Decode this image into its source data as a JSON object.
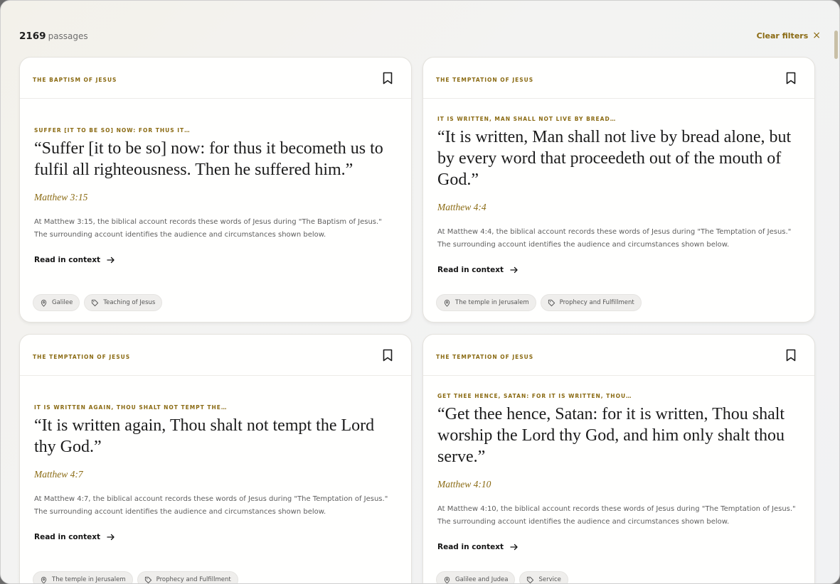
{
  "header": {
    "count": "2169",
    "count_label": "passages",
    "clear_label": "Clear filters",
    "clear_icon": "×"
  },
  "cards": [
    {
      "event": "THE BAPTISM OF JESUS",
      "kicker": "SUFFER [IT TO BE SO] NOW: FOR THUS IT…",
      "quote": "“Suffer [it to be so] now: for thus it becometh us to fulfil all righteousness. Then he suffered him.”",
      "ref": "Matthew 3:15",
      "desc": "At Matthew 3:15, the biblical account records these words of Jesus during \"The Baptism of Jesus.\" The surrounding account identifies the audience and circumstances shown below.",
      "read_label": "Read in context",
      "tags": [
        {
          "icon": "location-icon",
          "label": "Galilee"
        },
        {
          "icon": "tag-icon",
          "label": "Teaching of Jesus"
        }
      ]
    },
    {
      "event": "THE TEMPTATION OF JESUS",
      "kicker": "IT IS WRITTEN, MAN SHALL NOT LIVE BY BREAD…",
      "quote": "“It is written, Man shall not live by bread alone, but by every word that proceedeth out of the mouth of God.”",
      "ref": "Matthew 4:4",
      "desc": "At Matthew 4:4, the biblical account records these words of Jesus during \"The Temptation of Jesus.\" The surrounding account identifies the audience and circumstances shown below.",
      "read_label": "Read in context",
      "tags": [
        {
          "icon": "location-icon",
          "label": "The temple in Jerusalem"
        },
        {
          "icon": "tag-icon",
          "label": "Prophecy and Fulfillment"
        }
      ]
    },
    {
      "event": "THE TEMPTATION OF JESUS",
      "kicker": "IT IS WRITTEN AGAIN, THOU SHALT NOT TEMPT THE…",
      "quote": "“It is written again, Thou shalt not tempt the Lord thy God.”",
      "ref": "Matthew 4:7",
      "desc": "At Matthew 4:7, the biblical account records these words of Jesus during \"The Temptation of Jesus.\" The surrounding account identifies the audience and circumstances shown below.",
      "read_label": "Read in context",
      "tags": [
        {
          "icon": "location-icon",
          "label": "The temple in Jerusalem"
        },
        {
          "icon": "tag-icon",
          "label": "Prophecy and Fulfillment"
        }
      ]
    },
    {
      "event": "THE TEMPTATION OF JESUS",
      "kicker": "GET THEE HENCE, SATAN: FOR IT IS WRITTEN, THOU…",
      "quote": "“Get thee hence, Satan: for it is written, Thou shalt worship the Lord thy God, and him only shalt thou serve.”",
      "ref": "Matthew 4:10",
      "desc": "At Matthew 4:10, the biblical account records these words of Jesus during \"The Temptation of Jesus.\" The surrounding account identifies the audience and circumstances shown below.",
      "read_label": "Read in context",
      "tags": [
        {
          "icon": "location-icon",
          "label": "Galilee and Judea"
        },
        {
          "icon": "tag-icon",
          "label": "Service"
        }
      ]
    }
  ],
  "colors": {
    "accent": "#8a6a12",
    "text": "#1c1c1c",
    "muted": "#5e5e5e"
  }
}
